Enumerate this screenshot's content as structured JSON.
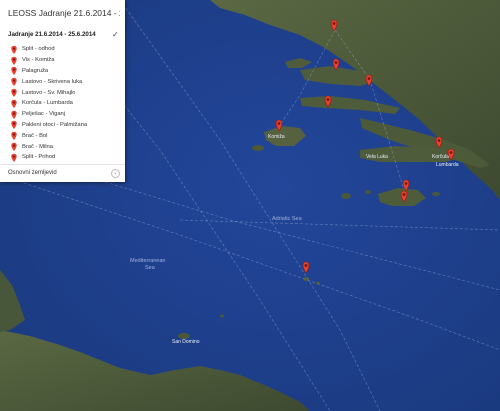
{
  "panel": {
    "title": "LEOSS Jadranje 21.6.2014 - 25....",
    "layer_title": "Jadranje 21.6.2014 - 25.6.2014",
    "items": [
      "Split - odhod",
      "Vis - Komiža",
      "Palagruža",
      "Lastovo - Skrivena luka",
      "Lastovo - Sv. Mihajlo",
      "Korčula - Lumbarda",
      "Pelješac - Viganj",
      "Pakleni otoci - Palmižana",
      "Brač - Bol",
      "Brač - Milna",
      "Split - Prihod"
    ],
    "basemap_label": "Osnovni zemljevid"
  },
  "map": {
    "sea_labels": {
      "adriatic": "Adriatic Sea",
      "mediterranean_line1": "Mediterranean",
      "mediterranean_line2": "Sea"
    },
    "island_labels": {
      "korcula": "Korčula",
      "lumbarda": "Lumbarda",
      "vela_luka": "Vela Luka",
      "vis": "Komiža",
      "san_domino": "San Domino"
    },
    "colors": {
      "sea": "#1e3f8a",
      "land": "#4e5a3c",
      "marker": "#e8412f"
    }
  }
}
